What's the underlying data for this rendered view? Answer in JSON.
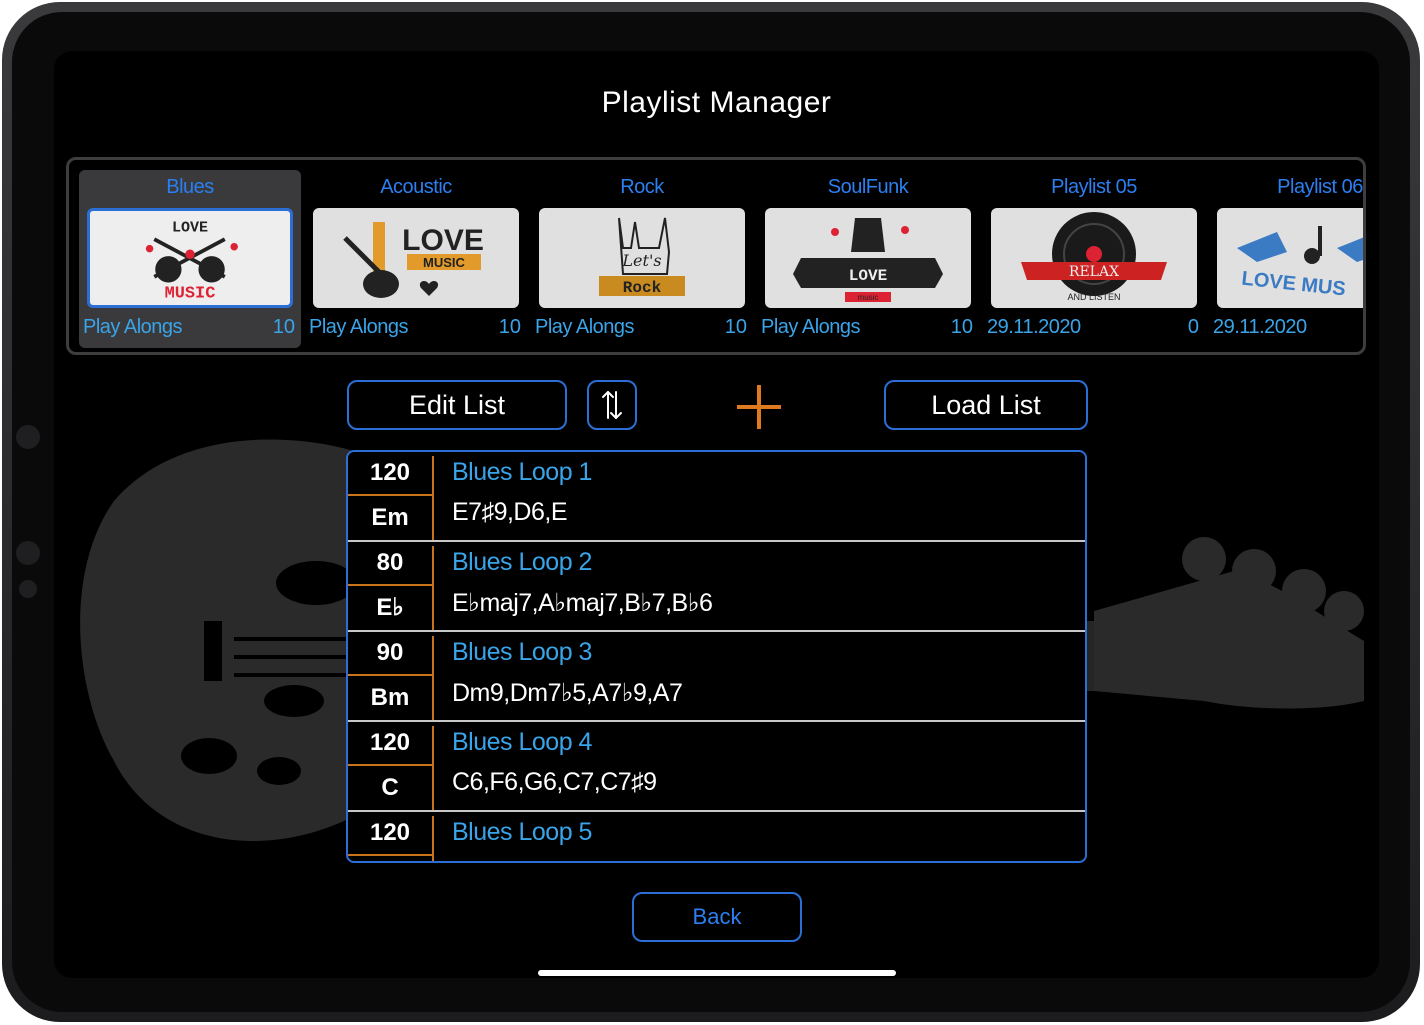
{
  "screen": {
    "title": "Playlist Manager"
  },
  "playlists": [
    {
      "name": "Blues",
      "subtitle": "Play Alongs",
      "count": "10",
      "selected": true,
      "thumb_icon": "love-music-guitars-icon",
      "thumb_text": [
        "LOVE",
        "MUSIC"
      ]
    },
    {
      "name": "Acoustic",
      "subtitle": "Play Alongs",
      "count": "10",
      "selected": false,
      "thumb_icon": "love-music-guitar-icon",
      "thumb_text": [
        "LOVE",
        "MUSIC"
      ]
    },
    {
      "name": "Rock",
      "subtitle": "Play Alongs",
      "count": "10",
      "selected": false,
      "thumb_icon": "rock-hand-icon",
      "thumb_text": [
        "Let's",
        "Rock"
      ]
    },
    {
      "name": "SoulFunk",
      "subtitle": "Play Alongs",
      "count": "10",
      "selected": false,
      "thumb_icon": "love-music-banner-icon",
      "thumb_text": [
        "LOVE",
        "music"
      ]
    },
    {
      "name": "Playlist 05",
      "subtitle": "29.11.2020",
      "count": "0",
      "selected": false,
      "thumb_icon": "vinyl-record-icon",
      "thumb_text": [
        "RELAX",
        "AND LISTEN"
      ]
    },
    {
      "name": "Playlist 06",
      "subtitle": "29.11.2020",
      "count": "",
      "selected": false,
      "thumb_icon": "winged-note-icon",
      "thumb_text": [
        "LOVE MUS"
      ]
    }
  ],
  "toolbar": {
    "edit_label": "Edit List",
    "sort_icon": "sort-arrows-icon",
    "add_icon": "plus-icon",
    "load_label": "Load List"
  },
  "loops": [
    {
      "tempo": "120",
      "key": "Em",
      "name": "Blues Loop 1",
      "chords": "E7♯9,D6,E"
    },
    {
      "tempo": "80",
      "key": "E♭",
      "name": "Blues Loop 2",
      "chords": "E♭maj7,A♭maj7,B♭7,B♭6"
    },
    {
      "tempo": "90",
      "key": "Bm",
      "name": "Blues Loop 3",
      "chords": "Dm9,Dm7♭5,A7♭9,A7"
    },
    {
      "tempo": "120",
      "key": "C",
      "name": "Blues Loop 4",
      "chords": "C6,F6,G6,C7,C7♯9"
    },
    {
      "tempo": "120",
      "key": "",
      "name": "Blues Loop 5",
      "chords": ""
    }
  ],
  "footer": {
    "back_label": "Back"
  },
  "colors": {
    "accent_blue": "#2b6fd6",
    "label_blue": "#3aa4e8",
    "orange": "#e07a1f",
    "background": "#000000"
  }
}
